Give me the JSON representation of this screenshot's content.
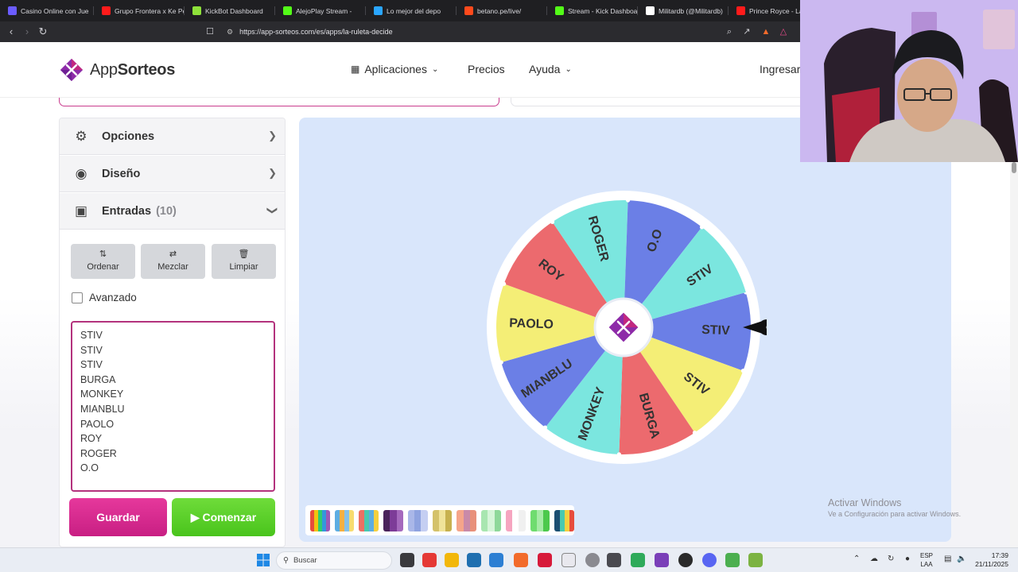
{
  "browser": {
    "tabs": [
      {
        "label": "Casino Online con Jue",
        "color": "#6b5cff"
      },
      {
        "label": "Grupo Frontera x Ke Pe",
        "color": "#ff1b1b"
      },
      {
        "label": "KickBot Dashboard",
        "color": "#8ee13a"
      },
      {
        "label": "AlejoPlay Stream -",
        "color": "#53fc18"
      },
      {
        "label": "Lo mejor del depo",
        "color": "#2aa6ff"
      },
      {
        "label": "betano.pe/live/",
        "color": "#ff4a1c"
      },
      {
        "label": "Stream - Kick Dashboa",
        "color": "#53fc18"
      },
      {
        "label": "Militardb (@Militardb)",
        "color": "#ffffff"
      },
      {
        "label": "Prince Royce - La",
        "color": "#ff1b1b"
      }
    ],
    "url": "https://app-sorteos.com/es/apps/la-ruleta-decide"
  },
  "header": {
    "logo_text_a": "App",
    "logo_text_b": "Sorteos",
    "nav_apps": "Aplicaciones",
    "nav_prices": "Precios",
    "nav_help": "Ayuda",
    "nav_login": "Ingresar"
  },
  "sidebar": {
    "options_label": "Opciones",
    "design_label": "Diseño",
    "entries_label": "Entradas",
    "entries_count": "(10)",
    "sort_label": "Ordenar",
    "shuffle_label": "Mezclar",
    "clear_label": "Limpiar",
    "advanced_label": "Avanzado",
    "entries": [
      "STIV",
      "STIV",
      "STIV",
      "BURGA",
      "MONKEY",
      "MIANBLU",
      "PAOLO",
      "ROY",
      "ROGER",
      "O.O"
    ],
    "save_label": "Guardar",
    "start_label": "Comenzar"
  },
  "wheel": {
    "start_angle_deg": -16,
    "segments": [
      {
        "label": "STIV",
        "color": "#6b7fe6"
      },
      {
        "label": "STIV",
        "color": "#f4ee76"
      },
      {
        "label": "BURGA",
        "color": "#ec6a6e"
      },
      {
        "label": "MONKEY",
        "color": "#7be6df"
      },
      {
        "label": "MIANBLU",
        "color": "#6b7fe6"
      },
      {
        "label": "PAOLO",
        "color": "#f4ee76"
      },
      {
        "label": "ROY",
        "color": "#ec6a6e"
      },
      {
        "label": "ROGER",
        "color": "#7be6df"
      },
      {
        "label": "O.O",
        "color": "#6b7fe6"
      },
      {
        "label": "STIV",
        "color": "#7be6df"
      }
    ]
  },
  "palettes": [
    [
      "#e74c3c",
      "#f1c40f",
      "#2ecc71",
      "#3498db",
      "#9b59b6"
    ],
    [
      "#5dade2",
      "#f5b041",
      "#85c1e9",
      "#f7dc6f"
    ],
    [
      "#ec7063",
      "#48c9b0",
      "#5dade2",
      "#f4d03f"
    ],
    [
      "#4a235a",
      "#7d3c98",
      "#a569bd"
    ],
    [
      "#aab7e8",
      "#8fa3e0",
      "#c5cff2"
    ],
    [
      "#d4c26a",
      "#f0e39a",
      "#c7b14f"
    ],
    [
      "#f5a58a",
      "#c98aa8",
      "#e8907a"
    ],
    [
      "#a8e6b0",
      "#d6f5d9",
      "#8ed89a"
    ],
    [
      "#f6a5c0",
      "#ffffff",
      "#f0f0f0"
    ],
    [
      "#6fdc6f",
      "#a6eba6",
      "#4cc94c"
    ],
    [
      "#1b4f72",
      "#48c9b0",
      "#f4d03f",
      "#e74c3c"
    ]
  ],
  "watermark": {
    "title": "Activar Windows",
    "subtitle": "Ve a Configuración para activar Windows."
  },
  "taskbar": {
    "search_placeholder": "Buscar",
    "lang_a": "ESP",
    "lang_b": "LAA",
    "time": "17:39",
    "date": "21/11/2025"
  }
}
